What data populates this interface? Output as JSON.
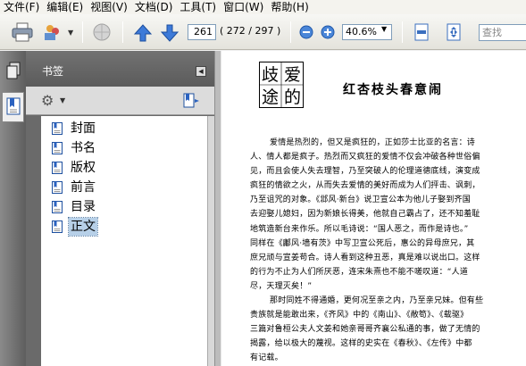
{
  "menu": [
    "文件(F)",
    "编辑(E)",
    "视图(V)",
    "文档(D)",
    "工具(T)",
    "窗口(W)",
    "帮助(H)"
  ],
  "toolbar": {
    "current_page": "261",
    "page_total": "( 272 / 297 )",
    "zoom": "40.6%",
    "find_placeholder": "查找",
    "icons": [
      "printer-icon",
      "collaborate-icon",
      "globe-icon",
      "page-up-icon",
      "page-down-icon",
      "zoom-out-icon",
      "zoom-in-icon",
      "fit-page-icon",
      "fit-width-icon"
    ]
  },
  "bookmarks": {
    "title": "书签",
    "items": [
      {
        "label": "封面",
        "selected": false
      },
      {
        "label": "书名",
        "selected": false
      },
      {
        "label": "版权",
        "selected": false
      },
      {
        "label": "前言",
        "selected": false
      },
      {
        "label": "目录",
        "selected": false
      },
      {
        "label": "正文",
        "selected": true
      }
    ]
  },
  "document": {
    "logo_chars": [
      "爱",
      "的",
      "歧",
      "途"
    ],
    "chapter_title": "红杏枝头春意闹",
    "lines": [
      {
        "text": "爱情是热烈的，但又是疯狂的，正如莎士比亚的名言：诗",
        "indent": true
      },
      {
        "text": "人、情人都是疯子。热烈而又疯狂的爱情不仅会冲破各种世俗偏",
        "indent": false
      },
      {
        "text": "见，而且会使人失去理智，乃至突破人的伦理道德底线，演变成",
        "indent": false
      },
      {
        "text": "疯狂的情欲之火，从而失去爱情的美好而成为人们抨击、讽刺，",
        "indent": false
      },
      {
        "text": "乃至诅咒的对象。《邶风·新台》说卫宣公本为他儿子娶到齐国",
        "indent": false
      },
      {
        "text": "去迎娶儿媳妇，因为新娘长得美，他就自己霸占了，还不知羞耻",
        "indent": false
      },
      {
        "text": "地筑造新台来作乐。所以毛诗说：“国人恶之，而作是诗也。”",
        "indent": false
      },
      {
        "text": "同样在《鄘风·墙有茨》中写卫宣公死后，惠公的异母庶兄，其",
        "indent": false
      },
      {
        "text": "庶兄顽与宣姜苟合。诗人看到这种丑恶，真是难以说出口。这样",
        "indent": false
      },
      {
        "text": "的行为不止为人们所厌恶，连宋朱熹也不能不嗟叹道：“人道",
        "indent": false
      },
      {
        "text": "尽，天理灭矣！”",
        "indent": false
      },
      {
        "text": "那时同姓不得通婚，更何况至亲之内，乃至亲兄妹。但有些",
        "indent": true
      },
      {
        "text": "贵族就是能敢出来，《齐风》中的《南山》、《敝笱》、《载驱》",
        "indent": false
      },
      {
        "text": "三篇对鲁桓公夫人文姜和她亲哥哥齐襄公私通的事，做了无情的",
        "indent": false
      },
      {
        "text": "揭露，给以极大的蔑视。这样的史实在《春秋》、《左传》中都",
        "indent": false
      },
      {
        "text": "有记载。",
        "indent": false
      }
    ]
  }
}
